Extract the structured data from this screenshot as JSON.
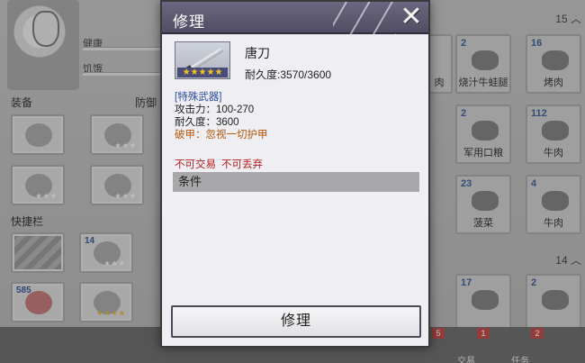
{
  "background": {
    "stats": {
      "health": "健康",
      "hunger": "饥饿"
    },
    "sections": {
      "equipment": "装备",
      "defense": "防御",
      "quickbar": "快捷栏"
    },
    "quickbar_counts": [
      "14",
      "585"
    ],
    "right_groups": {
      "first_count": "15",
      "second_count": "14"
    },
    "right_items": [
      {
        "count": "2",
        "name": "烧汁牛蛙腿"
      },
      {
        "count": "16",
        "name": "烤肉"
      },
      {
        "count": "2",
        "name": "军用口粮"
      },
      {
        "count": "112",
        "name": "牛肉"
      },
      {
        "count": "23",
        "name": "菠菜"
      },
      {
        "count": "4",
        "name": "牛肉"
      },
      {
        "count": "17",
        "name": ""
      },
      {
        "count": "2",
        "name": ""
      }
    ],
    "bottom_tabs": [
      {
        "label": "交易",
        "badge": "1"
      },
      {
        "label": "任务",
        "badge": "2"
      }
    ],
    "partial_food_label": "肉",
    "extra_badge": "5"
  },
  "dialog": {
    "title": "修理",
    "close_icon": "close-x-icon",
    "item": {
      "name": "唐刀",
      "stars": "★★★★★",
      "durability_label": "耐久度:",
      "durability_value": "3570/3600"
    },
    "details": {
      "type": "[特殊武器]",
      "attack": "攻击力：100-270",
      "durability": "耐久度：3600",
      "pierce": "破甲：忽视一切护甲"
    },
    "restrictions": {
      "no_trade": "不可交易",
      "no_drop": "不可丢弃"
    },
    "condition_label": "条件",
    "repair_button": "修理"
  },
  "colors": {
    "header": "#5e5a72",
    "type_text": "#2b4ea2",
    "pierce_text": "#b3560a",
    "restrict_text": "#b21d1d"
  }
}
